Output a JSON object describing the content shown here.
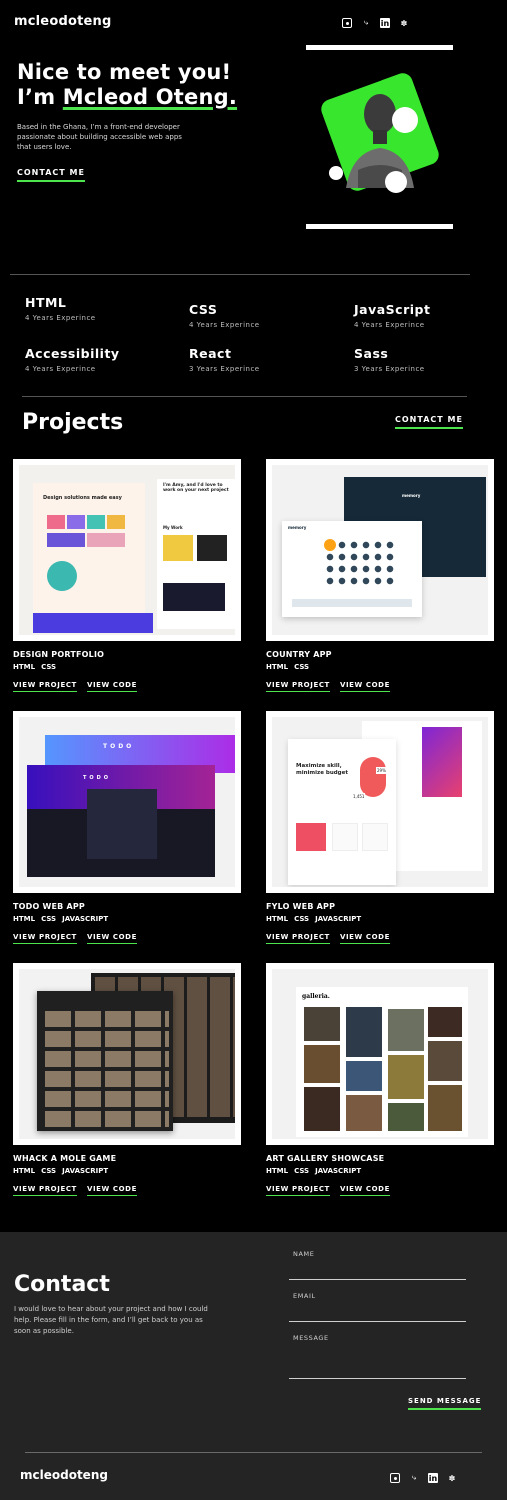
{
  "header": {
    "logo": "mcleodoteng",
    "social": [
      "github-icon",
      "frontend-mentor-icon",
      "linkedin-icon",
      "twitter-icon"
    ]
  },
  "hero": {
    "line1": "Nice to meet you!",
    "line2_prefix": "I’m ",
    "name": "Mcleod Oteng.",
    "description": "Based in the Ghana, I’m a front-end developer passionate about building accessible web apps that users love.",
    "cta": "CONTACT ME"
  },
  "skills": [
    {
      "name": "HTML",
      "exp": "4 Years Experince"
    },
    {
      "name": "CSS",
      "exp": "4 Years Experince"
    },
    {
      "name": "JavaScript",
      "exp": "4 Years Experince"
    },
    {
      "name": "Accessibility",
      "exp": "4 Years Experince"
    },
    {
      "name": "React",
      "exp": "3 Years Experince"
    },
    {
      "name": "Sass",
      "exp": "3 Years Experince"
    }
  ],
  "projects_section": {
    "title": "Projects",
    "cta": "CONTACT ME"
  },
  "projects": [
    {
      "title": "DESIGN PORTFOLIO",
      "tags": [
        "HTML",
        "CSS"
      ],
      "view": "VIEW PROJECT",
      "code": "VIEW CODE"
    },
    {
      "title": "COUNTRY APP",
      "tags": [
        "HTML",
        "CSS"
      ],
      "view": "VIEW PROJECT",
      "code": "VIEW CODE"
    },
    {
      "title": "TODO WEB APP",
      "tags": [
        "HTML",
        "CSS",
        "JAVASCRIPT"
      ],
      "view": "VIEW PROJECT",
      "code": "VIEW CODE"
    },
    {
      "title": "FYLO WEB APP",
      "tags": [
        "HTML",
        "CSS",
        "JAVASCRIPT"
      ],
      "view": "VIEW PROJECT",
      "code": "VIEW CODE"
    },
    {
      "title": "WHACK A MOLE GAME",
      "tags": [
        "HTML",
        "CSS",
        "JAVASCRIPT"
      ],
      "view": "VIEW PROJECT",
      "code": "VIEW CODE"
    },
    {
      "title": "ART GALLERY SHOWCASE",
      "tags": [
        "HTML",
        "CSS",
        "JAVASCRIPT"
      ],
      "view": "VIEW PROJECT",
      "code": "VIEW CODE"
    }
  ],
  "thumb_text": {
    "portfolio_heading": "Design solutions made easy",
    "portfolio_intro": "I'm Amy, and I'd love to work on your next project",
    "portfolio_work": "My Work",
    "memory_label": "memory",
    "todo_label": "TODO",
    "fylo_heading": "Maximize skill, minimize budget",
    "fylo_badge": "29%",
    "fylo_count": "1,451",
    "gallery_logo": "galleria."
  },
  "contact": {
    "title": "Contact",
    "description": "I would love to hear about your project and how I could help. Please fill in the form, and I’ll get back to you as soon as possible.",
    "name_label": "NAME",
    "email_label": "EMAIL",
    "message_label": "MESSAGE",
    "send": "SEND MESSAGE"
  },
  "footer": {
    "logo": "mcleodoteng"
  },
  "colors": {
    "accent": "#4ee44e",
    "background": "#000000",
    "contact_bg": "#242424"
  }
}
